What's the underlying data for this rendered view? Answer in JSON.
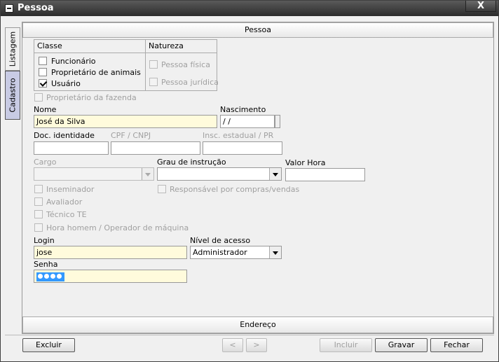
{
  "window": {
    "title": "Pessoa",
    "close_label": "X"
  },
  "side_tabs": [
    {
      "label": "Listagem"
    },
    {
      "label": "Cadastro"
    }
  ],
  "section_top": "Pessoa",
  "section_bottom": "Endereço",
  "classe": {
    "title": "Classe",
    "items": [
      {
        "label": "Funcionário",
        "checked": false
      },
      {
        "label": "Proprietário de animais",
        "checked": false
      },
      {
        "label": "Usuário",
        "checked": true
      }
    ]
  },
  "natureza": {
    "title": "Natureza",
    "items": [
      {
        "label": "Pessoa física"
      },
      {
        "label": "Pessoa jurídica"
      }
    ]
  },
  "proprietario_fazenda": "Proprietário da fazenda",
  "fields": {
    "nome": {
      "label": "Nome",
      "value": "José da Silva"
    },
    "nascimento": {
      "label": "Nascimento",
      "value": " / /"
    },
    "doc_identidade": {
      "label": "Doc. identidade",
      "value": ""
    },
    "cpf_cnpj": {
      "label": "CPF / CNPJ",
      "value": ""
    },
    "insc_estadual": {
      "label": "Insc. estadual / PR",
      "value": ""
    },
    "cargo": {
      "label": "Cargo",
      "value": ""
    },
    "grau_instrucao": {
      "label": "Grau de instrução",
      "value": ""
    },
    "valor_hora": {
      "label": "Valor Hora",
      "value": ""
    },
    "login": {
      "label": "Login",
      "value": "jose"
    },
    "nivel_acesso": {
      "label": "Nível de acesso",
      "value": "Administrador"
    },
    "senha": {
      "label": "Senha"
    }
  },
  "checkboxes": {
    "inseminador": "Inseminador",
    "avaliador": "Avaliador",
    "tecnico_te": "Técnico TE",
    "hora_homem": "Hora homem / Operador de máquina",
    "responsavel_compras": "Responsável por compras/vendas"
  },
  "buttons": {
    "excluir": "Excluir",
    "prev": "<",
    "next": ">",
    "incluir": "Incluir",
    "gravar": "Gravar",
    "fechar": "Fechar"
  }
}
